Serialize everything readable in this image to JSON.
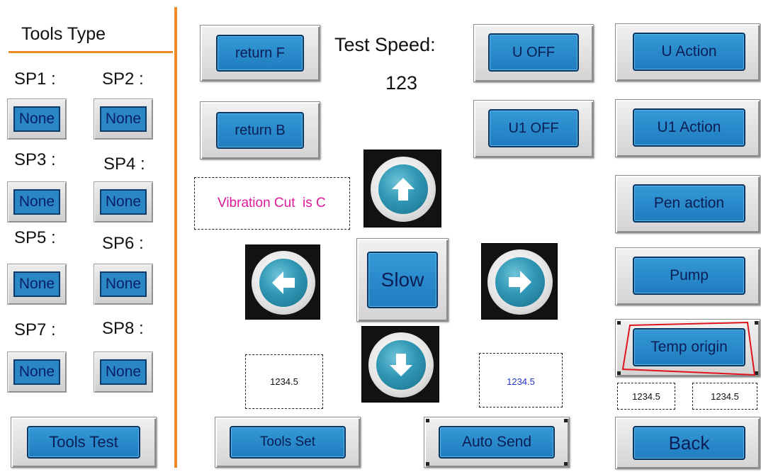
{
  "left_panel": {
    "title": "Tools Type",
    "sp": [
      {
        "label": "SP1 :",
        "value": "None"
      },
      {
        "label": "SP2 :",
        "value": "None"
      },
      {
        "label": "SP3 :",
        "value": "None"
      },
      {
        "label": "SP4 :",
        "value": "None"
      },
      {
        "label": "SP5 :",
        "value": "None"
      },
      {
        "label": "SP6 :",
        "value": "None"
      },
      {
        "label": "SP7 :",
        "value": "None"
      },
      {
        "label": "SP8 :",
        "value": "None"
      }
    ],
    "tools_test_label": "Tools Test"
  },
  "center": {
    "return_f_label": "return F",
    "return_b_label": "return B",
    "test_speed_label": "Test Speed:",
    "test_speed_value": "123",
    "vibration_text": "Vibration Cut  is C",
    "slow_label": "Slow",
    "display_left": "1234.5",
    "display_right": "1234.5",
    "tools_set_label": "Tools Set",
    "auto_send_label": "Auto Send"
  },
  "right": {
    "u_off_label": "U OFF",
    "u1_off_label": "U1 OFF",
    "u_action_label": "U Action",
    "u1_action_label": "U1 Action",
    "pen_action_label": "Pen action",
    "pump_label": "Pump",
    "temp_origin_label": "Temp origin",
    "display_a": "1234.5",
    "display_b": "1234.5",
    "back_label": "Back"
  },
  "icons": {
    "up": "arrow-up-icon",
    "down": "arrow-down-icon",
    "left": "arrow-left-icon",
    "right": "arrow-right-icon"
  },
  "colors": {
    "accent_orange": "#f08a24",
    "button_blue": "#2b86c6",
    "vibration_text": "#e0199a",
    "display_blue_text": "#2233cc",
    "highlight_red": "#e0141e"
  }
}
